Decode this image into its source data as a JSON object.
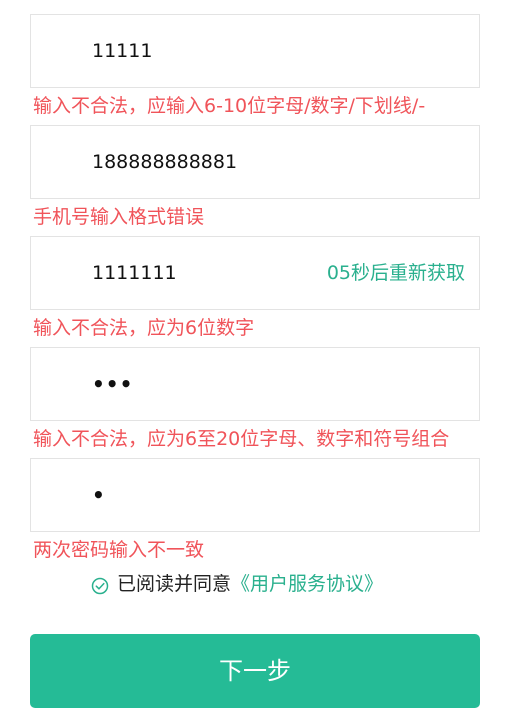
{
  "form": {
    "fields": [
      {
        "value": "11111",
        "error": "输入不合法，应输入6-10位字母/数字/下划线/-"
      },
      {
        "value": "188888888881",
        "error": "手机号输入格式错误"
      },
      {
        "value": "1111111",
        "action": "05秒后重新获取",
        "error": "输入不合法，应为6位数字"
      },
      {
        "value": "•••",
        "error": "输入不合法，应为6至20位字母、数字和符号组合"
      },
      {
        "value": "•",
        "error": "两次密码输入不一致"
      }
    ]
  },
  "agreement": {
    "icon": "check-circle-icon",
    "text": "已阅读并同意",
    "link": "《用户服务协议》",
    "color": "#2ab08e"
  },
  "next_button": {
    "label": "下一步",
    "color": "#25bb96"
  },
  "colors": {
    "error": "#f0545a",
    "accent": "#2ab08e",
    "border": "#e3e3e3"
  }
}
